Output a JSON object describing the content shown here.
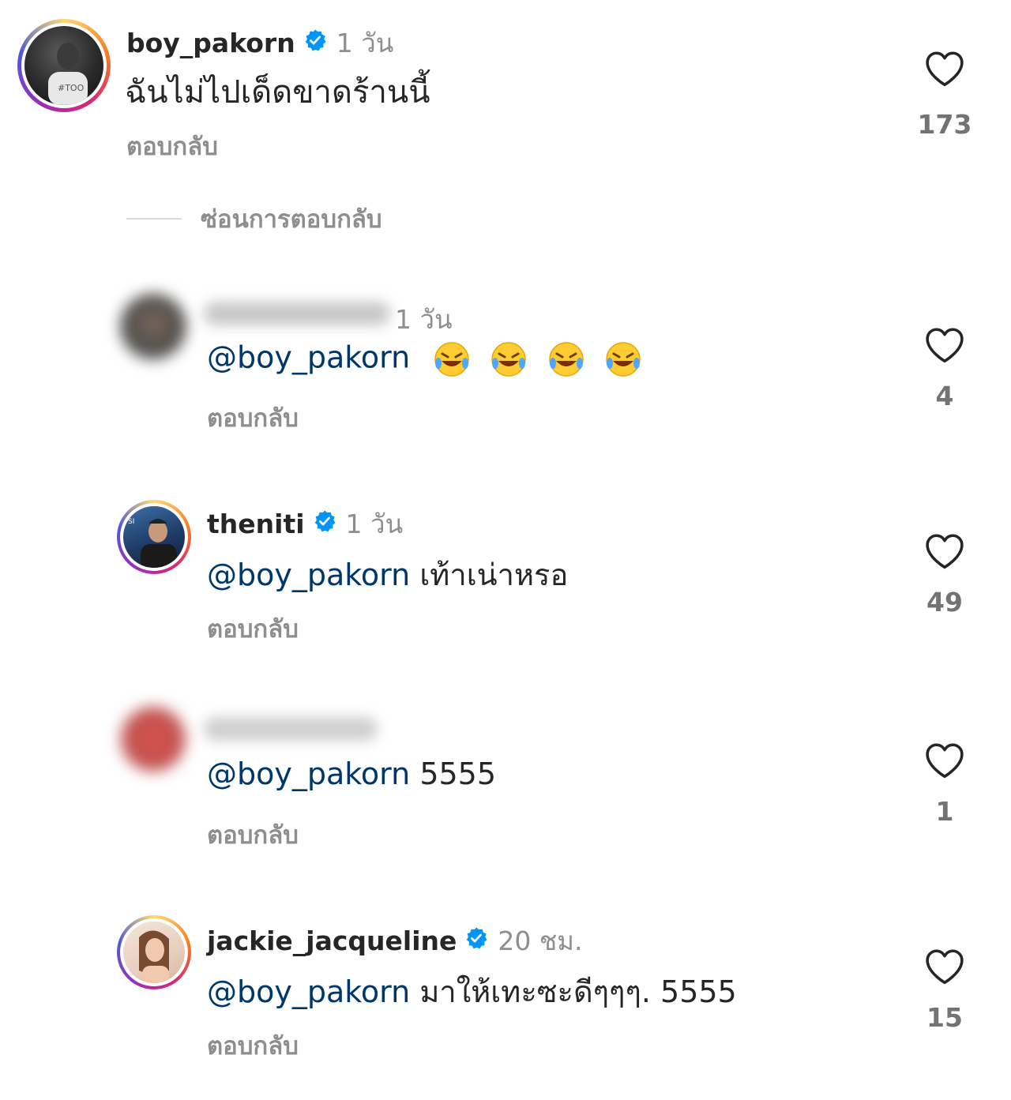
{
  "comments": [
    {
      "username": "boy_pakorn",
      "verified": true,
      "time": "1 วัน",
      "mention": "",
      "text": "ฉันไม่ไปเด็ดขาดร้านนี้",
      "reply_label": "ตอบกลับ",
      "likes": "173"
    },
    {
      "username": "",
      "verified": false,
      "time": "1 วัน",
      "mention": "@boy_pakorn",
      "text": "",
      "emoji": [
        "face-with-tears-of-joy",
        "face-with-tears-of-joy",
        "face-with-tears-of-joy",
        "face-with-tears-of-joy"
      ],
      "reply_label": "ตอบกลับ",
      "likes": "4"
    },
    {
      "username": "theniti",
      "verified": true,
      "time": "1 วัน",
      "mention": "@boy_pakorn",
      "text": "เท้าเน่าหรอ",
      "reply_label": "ตอบกลับ",
      "likes": "49"
    },
    {
      "username": "",
      "verified": false,
      "time": "",
      "mention": "@boy_pakorn",
      "text": "5555",
      "reply_label": "ตอบกลับ",
      "likes": "1"
    },
    {
      "username": "jackie_jacqueline",
      "verified": true,
      "time": "20 ชม.",
      "mention": "@boy_pakorn",
      "text": "มาให้เทะซะดีๆๆๆ. 5555",
      "reply_label": "ตอบกลับ",
      "likes": "15"
    }
  ],
  "hide_replies_label": "ซ่อนการตอบกลับ",
  "colors": {
    "mention": "#00376b",
    "verified": "#0095f6",
    "muted": "#8e8e8e"
  }
}
